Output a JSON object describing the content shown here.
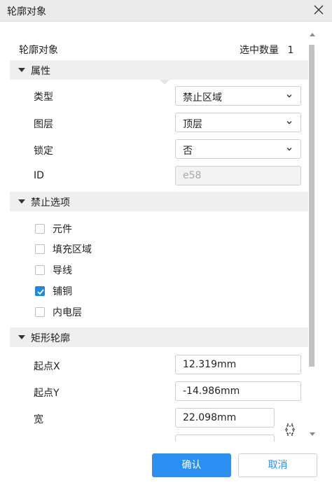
{
  "window": {
    "title": "轮廓对象"
  },
  "summary": {
    "label": "轮廓对象",
    "count_label": "选中数量",
    "count": "1"
  },
  "sections": {
    "attributes": {
      "title": "属性",
      "fields": [
        {
          "label": "类型",
          "value": "禁止区域"
        },
        {
          "label": "图层",
          "value": "顶层"
        },
        {
          "label": "锁定",
          "value": "否"
        },
        {
          "label": "ID",
          "value": "e58"
        }
      ]
    },
    "forbid": {
      "title": "禁止选项",
      "options": [
        {
          "label": "元件",
          "checked": false
        },
        {
          "label": "填充区域",
          "checked": false
        },
        {
          "label": "导线",
          "checked": false
        },
        {
          "label": "铺铜",
          "checked": true
        },
        {
          "label": "内电层",
          "checked": false
        }
      ]
    },
    "rect": {
      "title": "矩形轮廓",
      "fields": [
        {
          "label": "起点X",
          "value": "12.319mm"
        },
        {
          "label": "起点Y",
          "value": "-14.986mm"
        },
        {
          "label": "宽",
          "value": "22.098mm"
        }
      ]
    }
  },
  "buttons": {
    "confirm": "确认",
    "cancel": "取消"
  },
  "icons": [
    "close-icon",
    "chevron-down-icon",
    "checkmark-icon",
    "link-aspect-icon",
    "collapse-triangle-icon"
  ],
  "colors": {
    "accent": "#2b8ff2",
    "section_bg": "#efefef",
    "titlebar_bg": "#ebebeb"
  }
}
